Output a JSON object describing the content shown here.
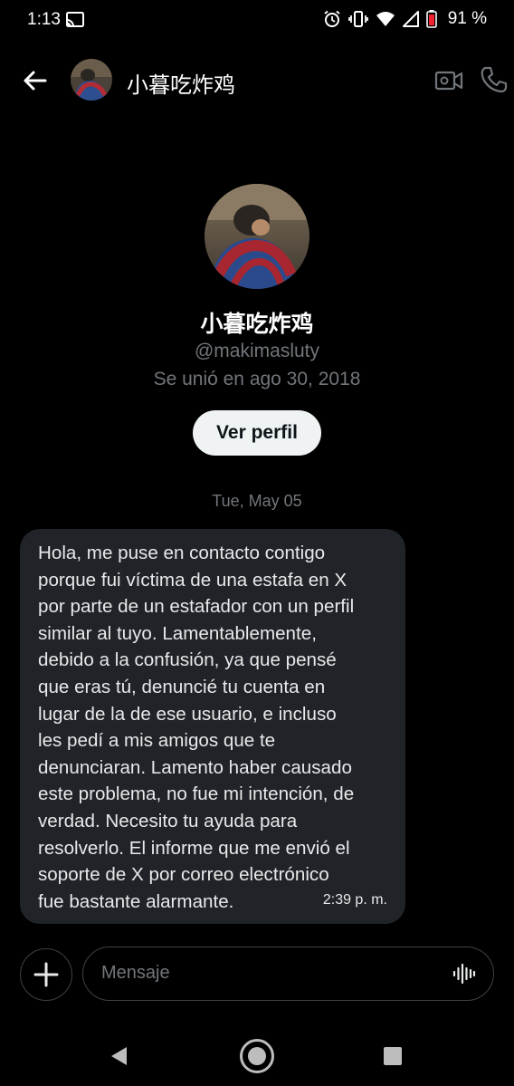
{
  "status_bar": {
    "time": "1:13",
    "battery": "91 %"
  },
  "header": {
    "name": "小暮吃炸鸡"
  },
  "profile": {
    "name": "小暮吃炸鸡",
    "handle": "@makimasluty",
    "joined": "Se unió en ago 30, 2018",
    "view_profile_label": "Ver perfil"
  },
  "conversation": {
    "date_separator": "Tue, May 05",
    "messages": [
      {
        "text": "Hola, me puse en contacto contigo\nporque fui víctima de una estafa en X\npor parte de un estafador con un perfil\nsimilar al tuyo. Lamentablemente,\ndebido a la confusión, ya que pensé\nque eras tú, denuncié tu cuenta en\nlugar de la de ese usuario, e incluso\nles pedí a mis amigos que te\ndenunciaran. Lamento haber causado\neste problema, no fue mi intención, de\nverdad. Necesito tu ayuda para\nresolverlo. El informe que me envió el\nsoporte de X por correo electrónico\nfue bastante alarmante.",
        "time": "2:39 p. m."
      }
    ]
  },
  "composer": {
    "placeholder": "Mensaje"
  },
  "colors": {
    "background": "#000000",
    "bubble": "#202327",
    "secondary_text": "#71767b",
    "button_bg": "#eff3f4"
  },
  "icons": {
    "status": [
      "cast-icon",
      "alarm-icon",
      "vibrate-icon",
      "wifi-icon",
      "signal-icon",
      "battery-icon"
    ],
    "header": [
      "back-arrow-icon",
      "video-camera-icon",
      "phone-icon"
    ],
    "composer": [
      "plus-icon",
      "voice-wave-icon"
    ],
    "nav": [
      "nav-back-icon",
      "nav-home-icon",
      "nav-recents-icon"
    ]
  }
}
